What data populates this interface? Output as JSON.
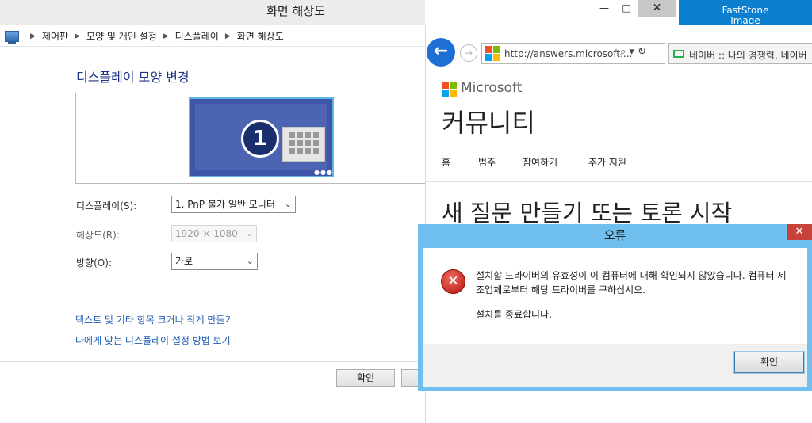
{
  "screen_resolution_window": {
    "title": "화면 해상도",
    "breadcrumb": [
      "제어판",
      "모양 및 개인 설정",
      "디스플레이",
      "화면 해상도"
    ],
    "heading": "디스플레이 모양 변경",
    "monitor_number": "1",
    "display_label": "디스플레이(S):",
    "display_value": "1. PnP 불가 일반 모니터",
    "resolution_label": "해상도(R):",
    "resolution_value": "1920 × 1080",
    "orientation_label": "방향(O):",
    "orientation_value": "가로",
    "links": [
      "텍스트 및 기타 항목 크거나 작게 만들기",
      "나에게 맞는 디스플레이 설정 방법 보기"
    ],
    "ok_label": "확인"
  },
  "caption_buttons": {
    "minimize": "—",
    "maximize": "□",
    "close": "✕"
  },
  "taskbar_tile": {
    "label": "FastStone",
    "label_cut": "Image"
  },
  "browser": {
    "url": "http://answers.microsoft....",
    "url_icons": "⌕ ▾ ↻",
    "tab_label": "네이버 :: 나의 경쟁력, 네이버",
    "brand": "Microsoft",
    "page_title": "커뮤니티",
    "nav": [
      "홈",
      "범주",
      "참여하기",
      "추가 지원"
    ],
    "question_heading": "새 질문 만들기 또는 토론 시작"
  },
  "error_dialog": {
    "title": "오류",
    "message": "설치할 드라이버의 유효성이 이 컴퓨터에 대해 확인되지 않았습니다. 컴퓨터 제조업체로부터 해당 드라이버를 구하십시오.",
    "message_2": "설치를 종료합니다.",
    "ok_label": "확인"
  },
  "colors": {
    "dialog_frame": "#6fc0ef",
    "link": "#1f5bb3",
    "heading": "#1e3287",
    "monitor": "#3f56a8",
    "error_close": "#c8423a",
    "back_button": "#1d6fd6"
  }
}
